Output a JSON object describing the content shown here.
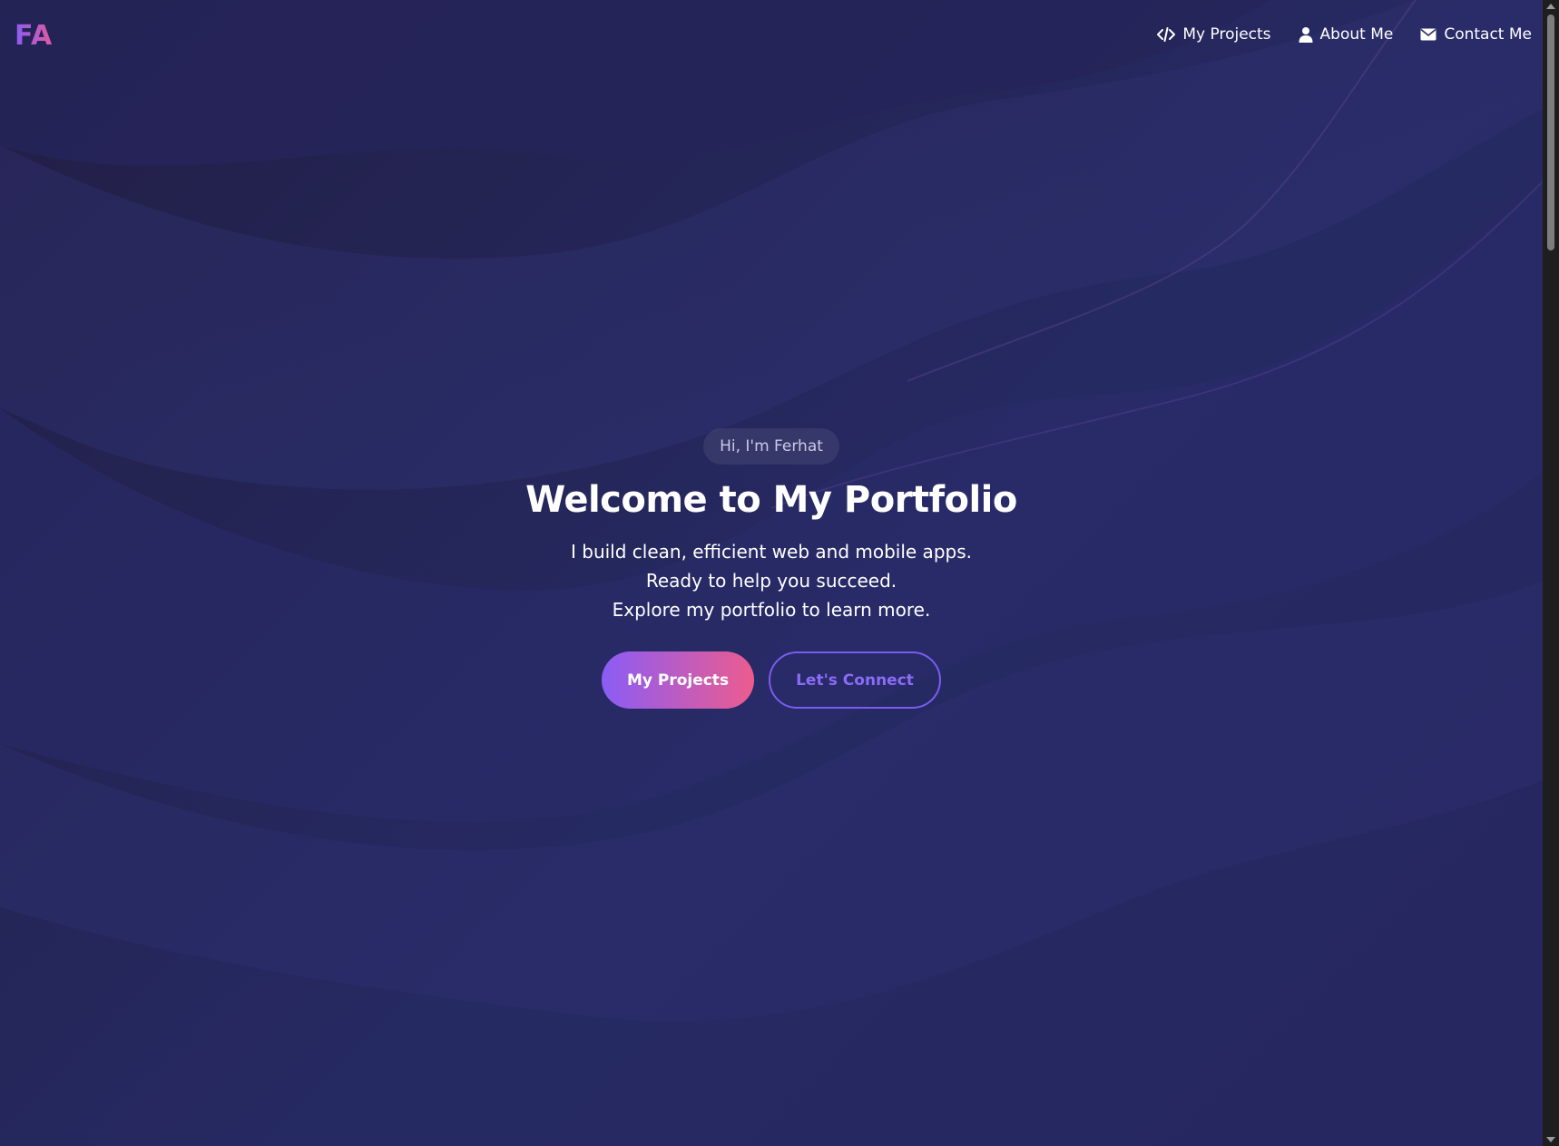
{
  "header": {
    "logo": "FA",
    "nav": [
      {
        "label": "My Projects",
        "icon": "code-icon"
      },
      {
        "label": "About Me",
        "icon": "user-icon"
      },
      {
        "label": "Contact Me",
        "icon": "envelope-icon"
      }
    ]
  },
  "hero": {
    "greeting": "Hi, I'm Ferhat",
    "title": "Welcome to My Portfolio",
    "tagline": [
      "I build clean, efficient web and mobile apps.",
      "Ready to help you succeed.",
      "Explore my portfolio to learn more."
    ],
    "primary_button": "My Projects",
    "secondary_button": "Let's Connect"
  },
  "colors": {
    "background": "#24224f",
    "accent_start": "#8b5cf6",
    "accent_end": "#ec5c8e"
  }
}
